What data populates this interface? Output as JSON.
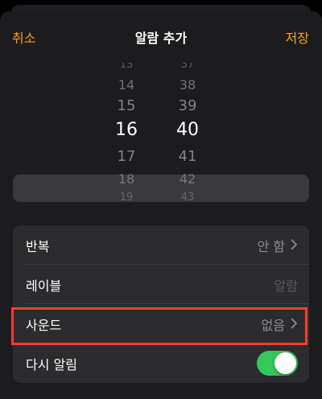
{
  "nav": {
    "cancel_label": "취소",
    "title": "알람 추가",
    "save_label": "저장"
  },
  "picker": {
    "hours": [
      "13",
      "14",
      "15",
      "16",
      "17",
      "18",
      "19"
    ],
    "minutes": [
      "37",
      "38",
      "39",
      "40",
      "41",
      "42",
      "43"
    ],
    "selected_hour": "16",
    "selected_minute": "40"
  },
  "settings": {
    "repeat": {
      "title": "반복",
      "value": "안 함"
    },
    "label": {
      "title": "레이블",
      "placeholder": "알람"
    },
    "sound": {
      "title": "사운드",
      "value": "없음"
    },
    "snooze": {
      "title": "다시 알림",
      "enabled": true
    }
  },
  "colors": {
    "accent": "#ff9f0a",
    "toggle_on": "#34c759",
    "highlight": "#ff3b30"
  }
}
